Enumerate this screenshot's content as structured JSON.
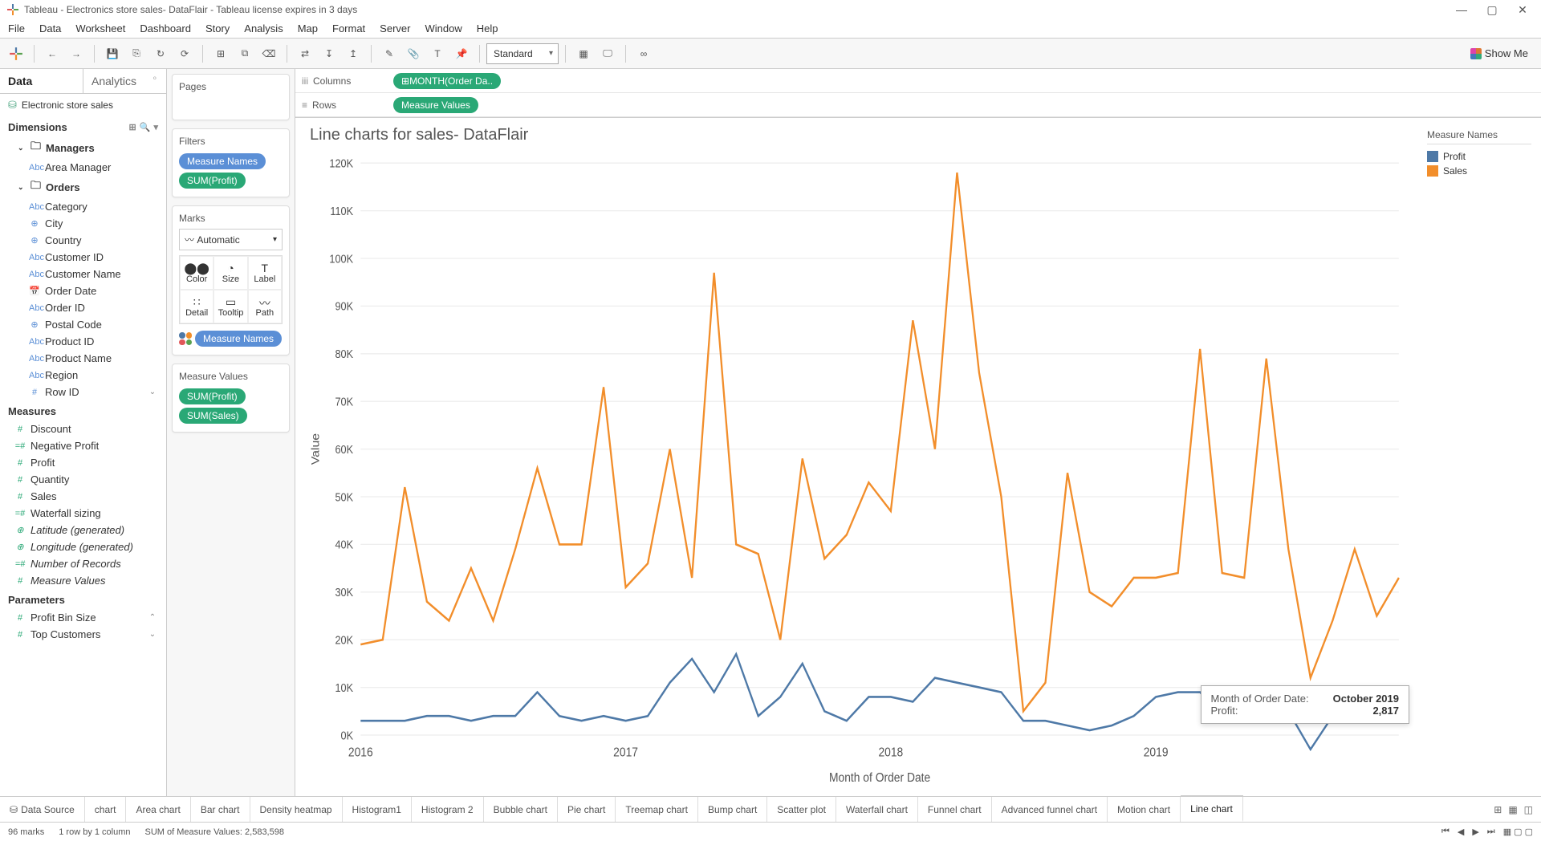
{
  "window": {
    "title": "Tableau - Electronics store sales- DataFlair - Tableau license expires in 3 days"
  },
  "menubar": [
    "File",
    "Data",
    "Worksheet",
    "Dashboard",
    "Story",
    "Analysis",
    "Map",
    "Format",
    "Server",
    "Window",
    "Help"
  ],
  "toolbar": {
    "fit_select": "Standard",
    "showme": "Show Me"
  },
  "data_pane": {
    "tabs": {
      "data": "Data",
      "analytics": "Analytics"
    },
    "datasource": "Electronic store sales",
    "dimensions_head": "Dimensions",
    "measures_head": "Measures",
    "parameters_head": "Parameters",
    "folders": {
      "managers": "Managers",
      "orders": "Orders"
    },
    "dimensions": {
      "area_manager": "Area Manager",
      "category": "Category",
      "city": "City",
      "country": "Country",
      "customer_id": "Customer ID",
      "customer_name": "Customer Name",
      "order_date": "Order Date",
      "order_id": "Order ID",
      "postal_code": "Postal Code",
      "product_id": "Product ID",
      "product_name": "Product Name",
      "region": "Region",
      "row_id": "Row ID"
    },
    "measures": {
      "discount": "Discount",
      "negative_profit": "Negative Profit",
      "profit": "Profit",
      "quantity": "Quantity",
      "sales": "Sales",
      "waterfall_sizing": "Waterfall sizing",
      "latitude": "Latitude (generated)",
      "longitude": "Longitude (generated)",
      "num_records": "Number of Records",
      "measure_values": "Measure Values"
    },
    "parameters": {
      "profit_bin": "Profit Bin Size",
      "top_customers": "Top Customers"
    }
  },
  "shelves": {
    "pages": "Pages",
    "filters": "Filters",
    "filter_pills": [
      "Measure Names",
      "SUM(Profit)"
    ],
    "marks": "Marks",
    "marks_type": "Automatic",
    "mark_cells": [
      "Color",
      "Size",
      "Label",
      "Detail",
      "Tooltip",
      "Path"
    ],
    "marks_color_pill": "Measure Names",
    "mv_head": "Measure Values",
    "mv_pills": [
      "SUM(Profit)",
      "SUM(Sales)"
    ]
  },
  "colrow": {
    "columns_label": "Columns",
    "rows_label": "Rows",
    "columns_pill": "MONTH(Order Da..",
    "rows_pill": "Measure Values"
  },
  "viz": {
    "title": "Line charts for sales- DataFlair",
    "legend_title": "Measure Names",
    "legend_items": [
      {
        "name": "Profit",
        "color": "#4e79a7"
      },
      {
        "name": "Sales",
        "color": "#f28e2b"
      }
    ],
    "tooltip": {
      "l1": "Month of Order Date:",
      "v1": "October 2019",
      "l2": "Profit:",
      "v2": "2,817"
    }
  },
  "chart_data": {
    "type": "line",
    "title": "Line charts for sales- DataFlair",
    "xlabel": "Month of Order Date",
    "ylabel": "Value",
    "ylim": [
      0,
      120000
    ],
    "yticks": [
      0,
      10000,
      20000,
      30000,
      40000,
      50000,
      60000,
      70000,
      80000,
      90000,
      100000,
      110000,
      120000
    ],
    "ytick_labels": [
      "0K",
      "10K",
      "20K",
      "30K",
      "40K",
      "50K",
      "60K",
      "70K",
      "80K",
      "90K",
      "100K",
      "110K",
      "120K"
    ],
    "x_year_labels": [
      "2016",
      "2017",
      "2018",
      "2019"
    ],
    "x": [
      0,
      1,
      2,
      3,
      4,
      5,
      6,
      7,
      8,
      9,
      10,
      11,
      12,
      13,
      14,
      15,
      16,
      17,
      18,
      19,
      20,
      21,
      22,
      23,
      24,
      25,
      26,
      27,
      28,
      29,
      30,
      31,
      32,
      33,
      34,
      35,
      36,
      37,
      38,
      39,
      40,
      41,
      42,
      43,
      44,
      45,
      46,
      47
    ],
    "series": [
      {
        "name": "Sales",
        "color": "#f28e2b",
        "values": [
          19000,
          20000,
          52000,
          28000,
          24000,
          35000,
          24000,
          39000,
          56000,
          40000,
          40000,
          73000,
          31000,
          36000,
          60000,
          33000,
          97000,
          40000,
          38000,
          20000,
          58000,
          37000,
          42000,
          53000,
          47000,
          87000,
          60000,
          118000,
          76000,
          50000,
          5000,
          11000,
          55000,
          30000,
          27000,
          33000,
          33000,
          34000,
          81000,
          34000,
          33000,
          79000,
          39000,
          12000,
          24000,
          39000,
          25000,
          33000
        ]
      },
      {
        "name": "Profit",
        "color": "#4e79a7",
        "values": [
          3000,
          3000,
          3000,
          4000,
          4000,
          3000,
          4000,
          4000,
          9000,
          4000,
          3000,
          4000,
          3000,
          4000,
          11000,
          16000,
          9000,
          17000,
          4000,
          8000,
          15000,
          5000,
          3000,
          8000,
          8000,
          7000,
          12000,
          11000,
          10000,
          9000,
          3000,
          3000,
          2000,
          1000,
          2000,
          4000,
          8000,
          9000,
          9000,
          4000,
          4000,
          10000,
          5000,
          -3000,
          4000,
          4000,
          3000,
          4000
        ]
      }
    ]
  },
  "sheet_tabs": [
    "Data Source",
    "chart",
    "Area chart",
    "Bar chart",
    "Density heatmap",
    "Histogram1",
    "Histogram 2",
    "Bubble chart",
    "Pie chart",
    "Treemap chart",
    "Bump chart",
    "Scatter plot",
    "Waterfall chart",
    "Funnel chart",
    "Advanced funnel chart",
    "Motion chart",
    "Line chart"
  ],
  "status": {
    "marks": "96 marks",
    "rowcol": "1 row by 1 column",
    "sum": "SUM of Measure Values: 2,583,598"
  }
}
